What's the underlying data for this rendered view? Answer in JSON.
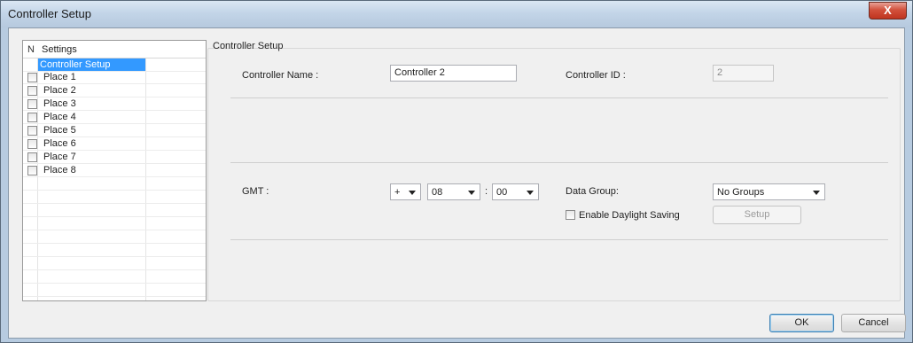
{
  "window": {
    "title": "Controller Setup",
    "close_label": "X"
  },
  "sidebar": {
    "col_marker": "N",
    "col_header": "Settings",
    "selected": "Controller Setup",
    "items": [
      "Place 1",
      "Place 2",
      "Place 3",
      "Place 4",
      "Place 5",
      "Place 6",
      "Place 7",
      "Place 8"
    ]
  },
  "group": {
    "title": "Controller Setup"
  },
  "controller": {
    "name_label": "Controller Name :",
    "name_value": "Controller 2",
    "id_label": "Controller ID :",
    "id_value": "2"
  },
  "gmt": {
    "label": "GMT :",
    "sign": "+",
    "hours": "08",
    "colon": ":",
    "minutes": "00"
  },
  "data_group": {
    "label": "Data Group:",
    "value": "No Groups"
  },
  "daylight": {
    "label": "Enable Daylight Saving",
    "checked": false,
    "setup_label": "Setup"
  },
  "buttons": {
    "ok": "OK",
    "cancel": "Cancel"
  }
}
